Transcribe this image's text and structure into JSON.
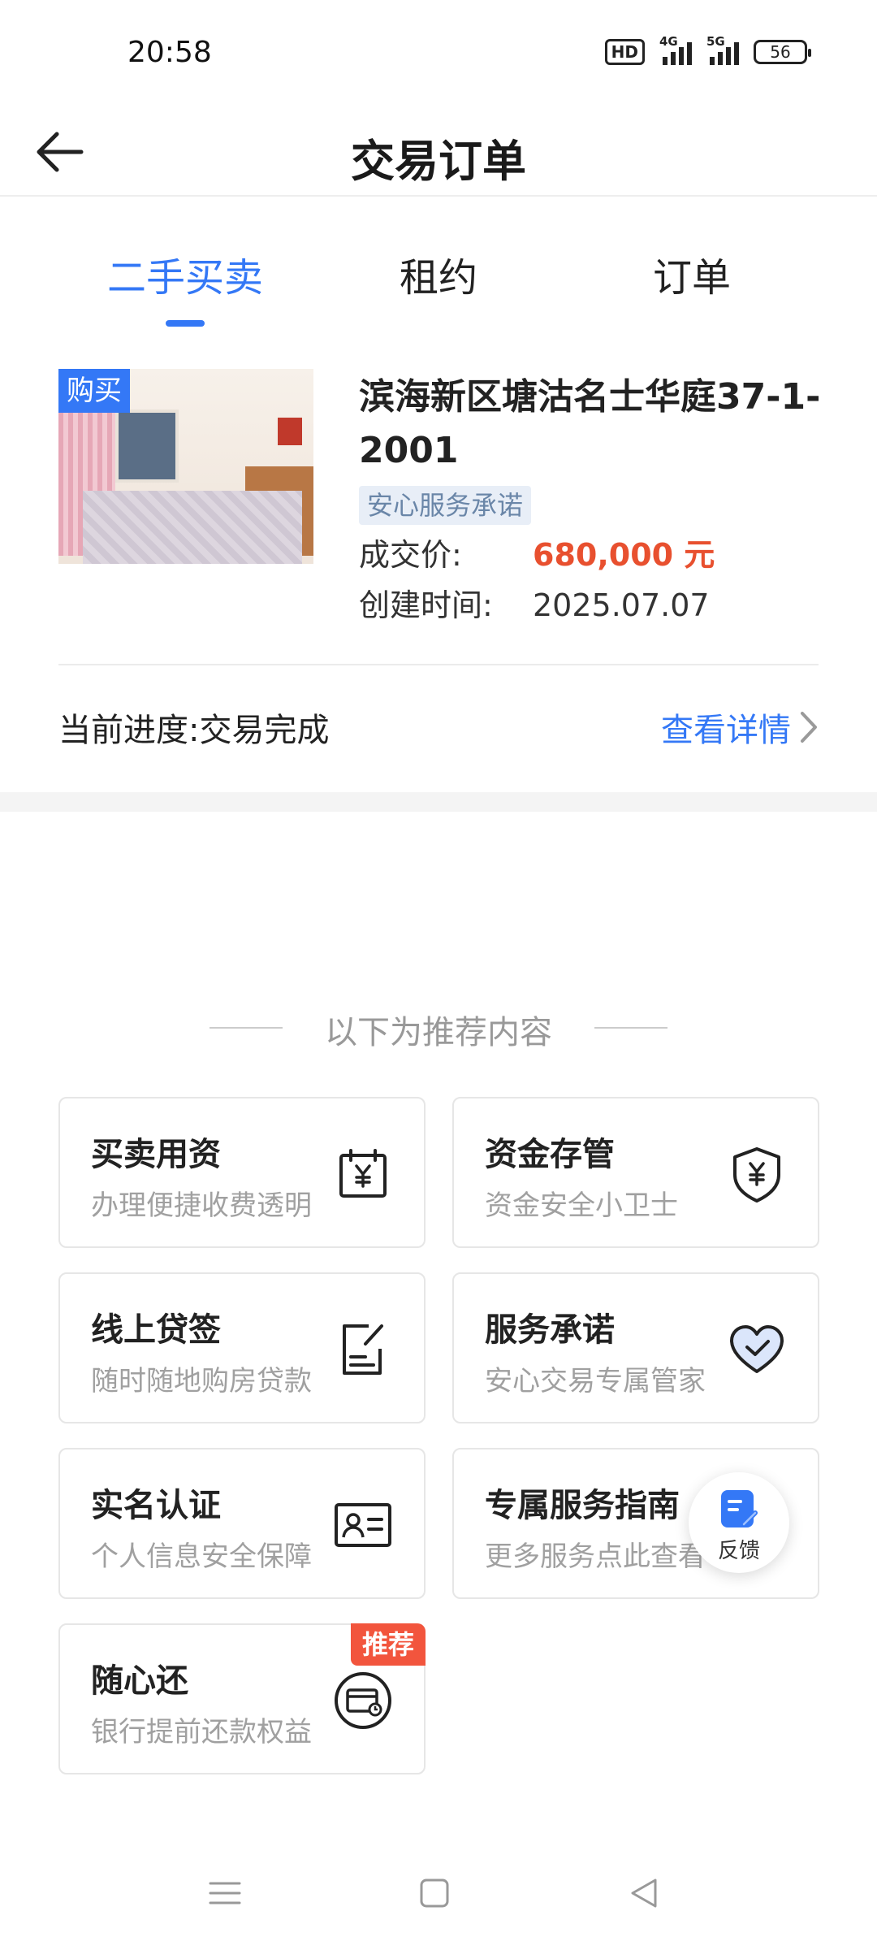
{
  "status_bar": {
    "time": "20:58",
    "hd_label": "HD",
    "network_1": "4G",
    "network_2": "5G",
    "battery": "56"
  },
  "header": {
    "title": "交易订单",
    "back_icon": "arrow-left-icon"
  },
  "tabs": [
    {
      "label": "二手买卖",
      "active": true
    },
    {
      "label": "租约",
      "active": false
    },
    {
      "label": "订单",
      "active": false
    }
  ],
  "order": {
    "badge": "购买",
    "title": "滨海新区塘沽名士华庭37-1-2001",
    "tag": "安心服务承诺",
    "price_label": "成交价:",
    "price_value": "680,000 元",
    "created_label": "创建时间:",
    "created_value": "2025.07.07",
    "progress_text": "当前进度:交易完成",
    "detail_link": "查看详情"
  },
  "recommend": {
    "heading": "以下为推荐内容",
    "items": [
      {
        "title": "买卖用资",
        "subtitle": "办理便捷收费透明",
        "icon": "calendar-yen-icon"
      },
      {
        "title": "资金存管",
        "subtitle": "资金安全小卫士",
        "icon": "shield-yen-icon"
      },
      {
        "title": "线上贷签",
        "subtitle": "随时随地购房贷款",
        "icon": "sign-document-icon"
      },
      {
        "title": "服务承诺",
        "subtitle": "安心交易专属管家",
        "icon": "heart-check-icon"
      },
      {
        "title": "实名认证",
        "subtitle": "个人信息安全保障",
        "icon": "id-card-icon"
      },
      {
        "title": "专属服务指南",
        "subtitle": "更多服务点此查看",
        "icon": "guide-icon"
      },
      {
        "title": "随心还",
        "subtitle": "银行提前还款权益",
        "icon": "card-clock-icon",
        "badge": "推荐"
      }
    ]
  },
  "feedback": {
    "label": "反馈"
  },
  "colors": {
    "accent": "#3478f6",
    "price": "#e8502f",
    "badge_red": "#f2553d"
  }
}
